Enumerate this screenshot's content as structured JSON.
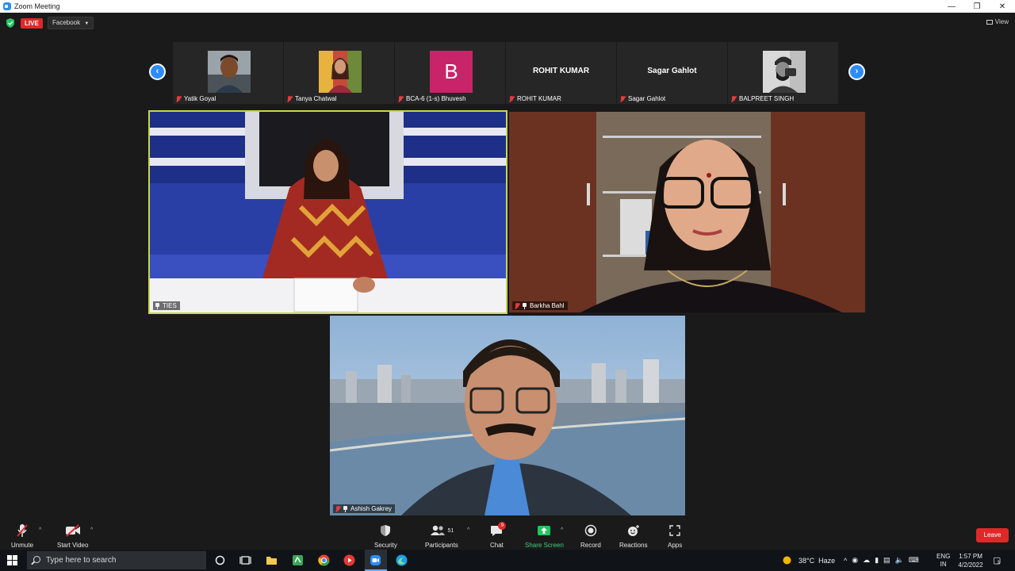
{
  "window": {
    "title": "Zoom Meeting"
  },
  "topbar": {
    "live_label": "LIVE",
    "stream_target": "Facebook",
    "view_label": "View"
  },
  "thumbnails": [
    {
      "name": "Yatik Goyal",
      "display": "photo"
    },
    {
      "name": "Tanya Chatwal",
      "display": "photo"
    },
    {
      "name": "BCA-6 (1-s) Bhuvesh",
      "display": "letter",
      "letter": "B",
      "color": "#c8246a"
    },
    {
      "name": "ROHIT KUMAR",
      "display": "name",
      "display_name": "ROHIT KUMAR"
    },
    {
      "name": "Sagar Gahlot",
      "display": "name",
      "display_name": "Sagar Gahlot"
    },
    {
      "name": "BALPREET SINGH",
      "display": "photo"
    }
  ],
  "video_tiles": [
    {
      "name": "TIES",
      "active_speaker": true,
      "highlight_color": "#c5d84a"
    },
    {
      "name": "Barkha Bahl"
    },
    {
      "name": "Ashish Gakrey"
    }
  ],
  "toolbar": {
    "unmute": "Unmute",
    "start_video": "Start Video",
    "security": "Security",
    "participants": "Participants",
    "participants_count": "51",
    "chat": "Chat",
    "chat_badge": "9",
    "share_screen": "Share Screen",
    "record": "Record",
    "reactions": "Reactions",
    "apps": "Apps",
    "leave": "Leave"
  },
  "taskbar": {
    "search_placeholder": "Type here to search",
    "weather": "38°C  Haze",
    "lang_top": "ENG",
    "lang_bottom": "IN",
    "time": "1:57 PM",
    "date": "4/2/2022",
    "notif_count": "3"
  },
  "colors": {
    "accent": "#2d8cff",
    "live": "#e02828",
    "share": "#22c55e"
  }
}
